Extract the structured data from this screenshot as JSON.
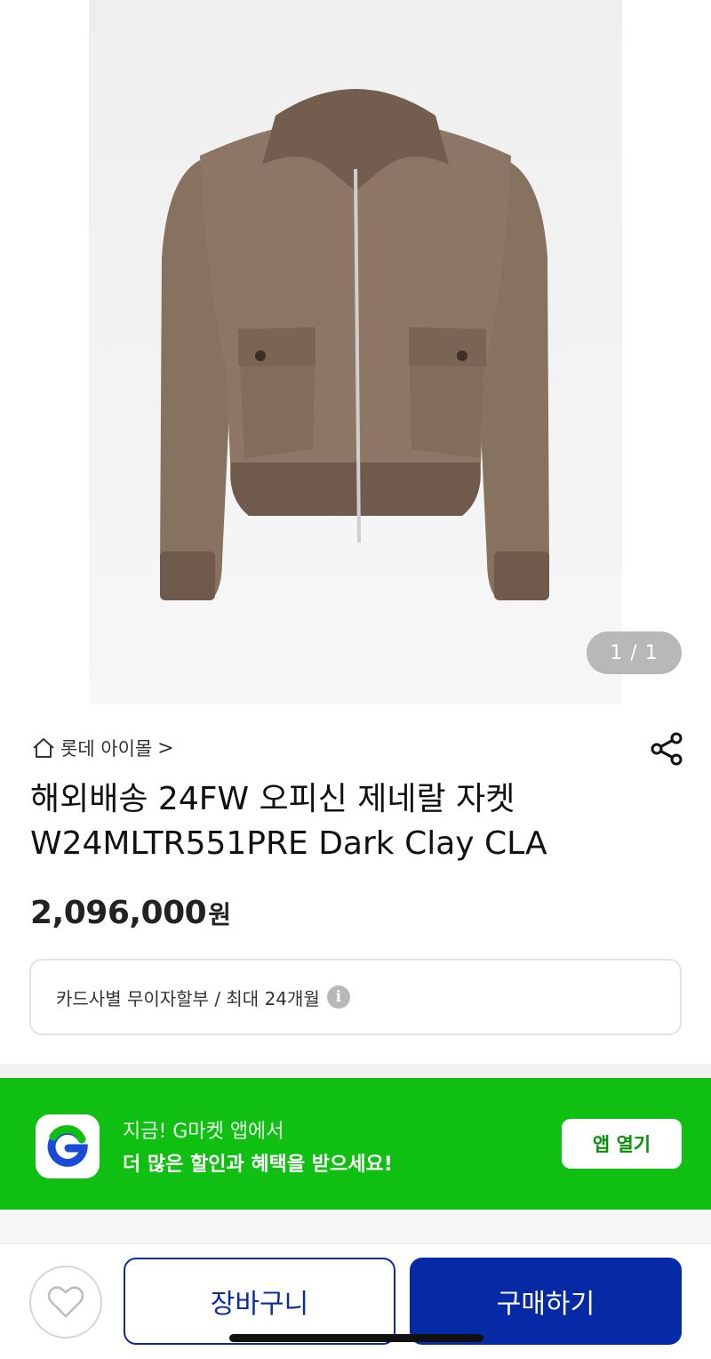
{
  "gallery": {
    "page_indicator": "1 / 1",
    "image_icon": "jacket-photo",
    "colors": {
      "jacket_body": "#8a7463",
      "jacket_rib": "#6f5a4b"
    }
  },
  "seller": {
    "name": "롯데 아이몰",
    "chevron": ">"
  },
  "product": {
    "title_line1": "해외배송 24FW 오피신 제네랄 자켓",
    "title_line2": "W24MLTR551PRE Dark Clay CLA",
    "price": "2,096,000",
    "price_unit": "원"
  },
  "installment": {
    "text": "카드사별 무이자할부 / 최대 24개월",
    "info_glyph": "i"
  },
  "banner": {
    "line1": "지금! G마켓 앱에서",
    "line2": "더 많은 할인과 혜택을 받으세요!",
    "open_app_label": "앱 열기",
    "background_color": "#0fbf12",
    "logo_letter": "G"
  },
  "actions": {
    "cart_label": "장바구니",
    "buy_label": "구매하기",
    "accent_color": "#0629a6"
  }
}
